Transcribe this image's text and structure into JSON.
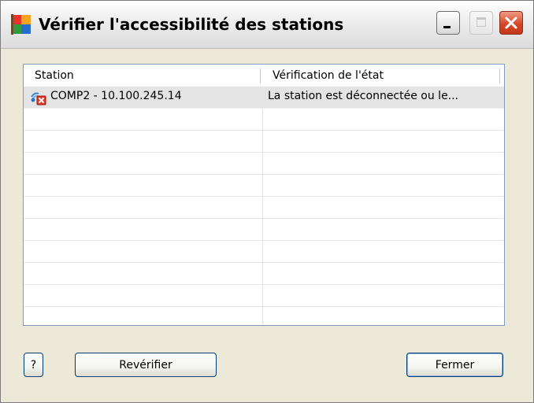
{
  "window": {
    "title": "Vérifier l'accessibilité des stations",
    "app_icon": "avg-flag-icon",
    "controls": {
      "minimize": "minimize-icon",
      "maximize": "maximize-icon",
      "close": "close-icon"
    }
  },
  "list": {
    "columns": [
      "Station",
      "Vérification de l'état"
    ],
    "rows": [
      {
        "station": "COMP2 - 10.100.245.14",
        "state": "La station est déconnectée ou le...",
        "icon": "station-disconnected-icon",
        "selected": true
      },
      {
        "station": "",
        "state": ""
      },
      {
        "station": "",
        "state": ""
      },
      {
        "station": "",
        "state": ""
      },
      {
        "station": "",
        "state": ""
      },
      {
        "station": "",
        "state": ""
      },
      {
        "station": "",
        "state": ""
      },
      {
        "station": "",
        "state": ""
      },
      {
        "station": "",
        "state": ""
      },
      {
        "station": "",
        "state": ""
      },
      {
        "station": "",
        "state": ""
      }
    ]
  },
  "buttons": {
    "help": "?",
    "recheck": "Revérifier",
    "close": "Fermer"
  },
  "colors": {
    "accent_blue": "#003c74",
    "close_red": "#d7482a",
    "dialog_bg": "#ece9d8"
  }
}
